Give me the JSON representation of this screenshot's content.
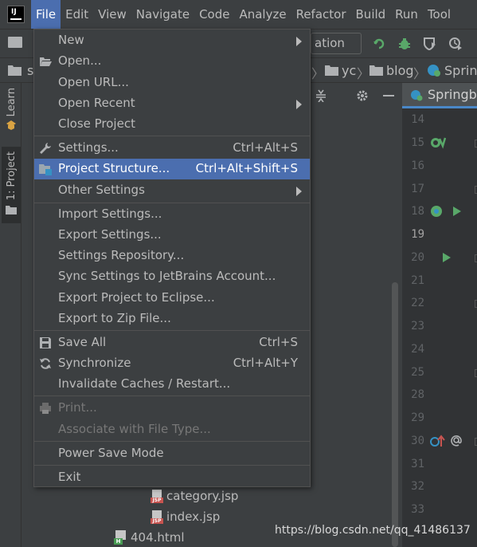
{
  "menubar": {
    "items": [
      {
        "label": "File",
        "active": true
      },
      {
        "label": "Edit"
      },
      {
        "label": "View"
      },
      {
        "label": "Navigate"
      },
      {
        "label": "Code"
      },
      {
        "label": "Analyze"
      },
      {
        "label": "Refactor"
      },
      {
        "label": "Build"
      },
      {
        "label": "Run"
      },
      {
        "label": "Tool"
      }
    ]
  },
  "toolbar": {
    "run_config": "ation",
    "icons": [
      "open-folder-icon",
      "build-icon",
      "debug-icon",
      "coverage-icon",
      "profile-icon"
    ]
  },
  "breadcrumb": {
    "first": "s",
    "items": [
      "yc",
      "blog",
      "Spring"
    ]
  },
  "tool_strip": {
    "learn": "Learn",
    "project": "1: Project"
  },
  "project_tree": {
    "rows": [
      {
        "name": "category.jsp",
        "icon": "jsp-file-icon"
      },
      {
        "name": "index.jsp",
        "icon": "jsp-file-icon"
      },
      {
        "name": "404.html",
        "icon": "html-file-icon"
      }
    ],
    "jsp_tag": "JSP",
    "html_tag": "H"
  },
  "editor": {
    "tab_label": "Springb",
    "line_numbers": [
      "14",
      "15",
      "16",
      "17",
      "18",
      "19",
      "20",
      "21",
      "22",
      "23",
      "24",
      "25",
      "28",
      "29",
      "30",
      "31",
      "32",
      "33"
    ],
    "current_line": "19"
  },
  "file_menu": {
    "items": [
      {
        "label": "New",
        "submenu": true
      },
      {
        "label": "Open...",
        "icon": "folder-open-icon"
      },
      {
        "label": "Open URL..."
      },
      {
        "label": "Open Recent",
        "submenu": true
      },
      {
        "label": "Close Project"
      },
      {
        "label": "Settings...",
        "shortcut": "Ctrl+Alt+S",
        "icon": "wrench-icon"
      },
      {
        "label": "Project Structure...",
        "shortcut": "Ctrl+Alt+Shift+S",
        "icon": "project-structure-icon",
        "highlighted": true
      },
      {
        "label": "Other Settings",
        "submenu": true
      },
      {
        "label": "Import Settings..."
      },
      {
        "label": "Export Settings..."
      },
      {
        "label": "Settings Repository..."
      },
      {
        "label": "Sync Settings to JetBrains Account..."
      },
      {
        "label": "Export Project to Eclipse..."
      },
      {
        "label": "Export to Zip File..."
      },
      {
        "label": "Save All",
        "shortcut": "Ctrl+S",
        "icon": "save-icon"
      },
      {
        "label": "Synchronize",
        "shortcut": "Ctrl+Alt+Y",
        "icon": "sync-icon"
      },
      {
        "label": "Invalidate Caches / Restart..."
      },
      {
        "label": "Print...",
        "disabled": true,
        "icon": "print-icon"
      },
      {
        "label": "Associate with File Type...",
        "disabled": true
      },
      {
        "label": "Power Save Mode"
      },
      {
        "label": "Exit"
      }
    ]
  },
  "watermark": "https://blog.csdn.net/qq_41486137",
  "colors": {
    "menu_highlight": "#4b6eaf",
    "panel_bg": "#3c3f41",
    "editor_bg": "#2b2b2b",
    "gutter_bg": "#313335"
  }
}
